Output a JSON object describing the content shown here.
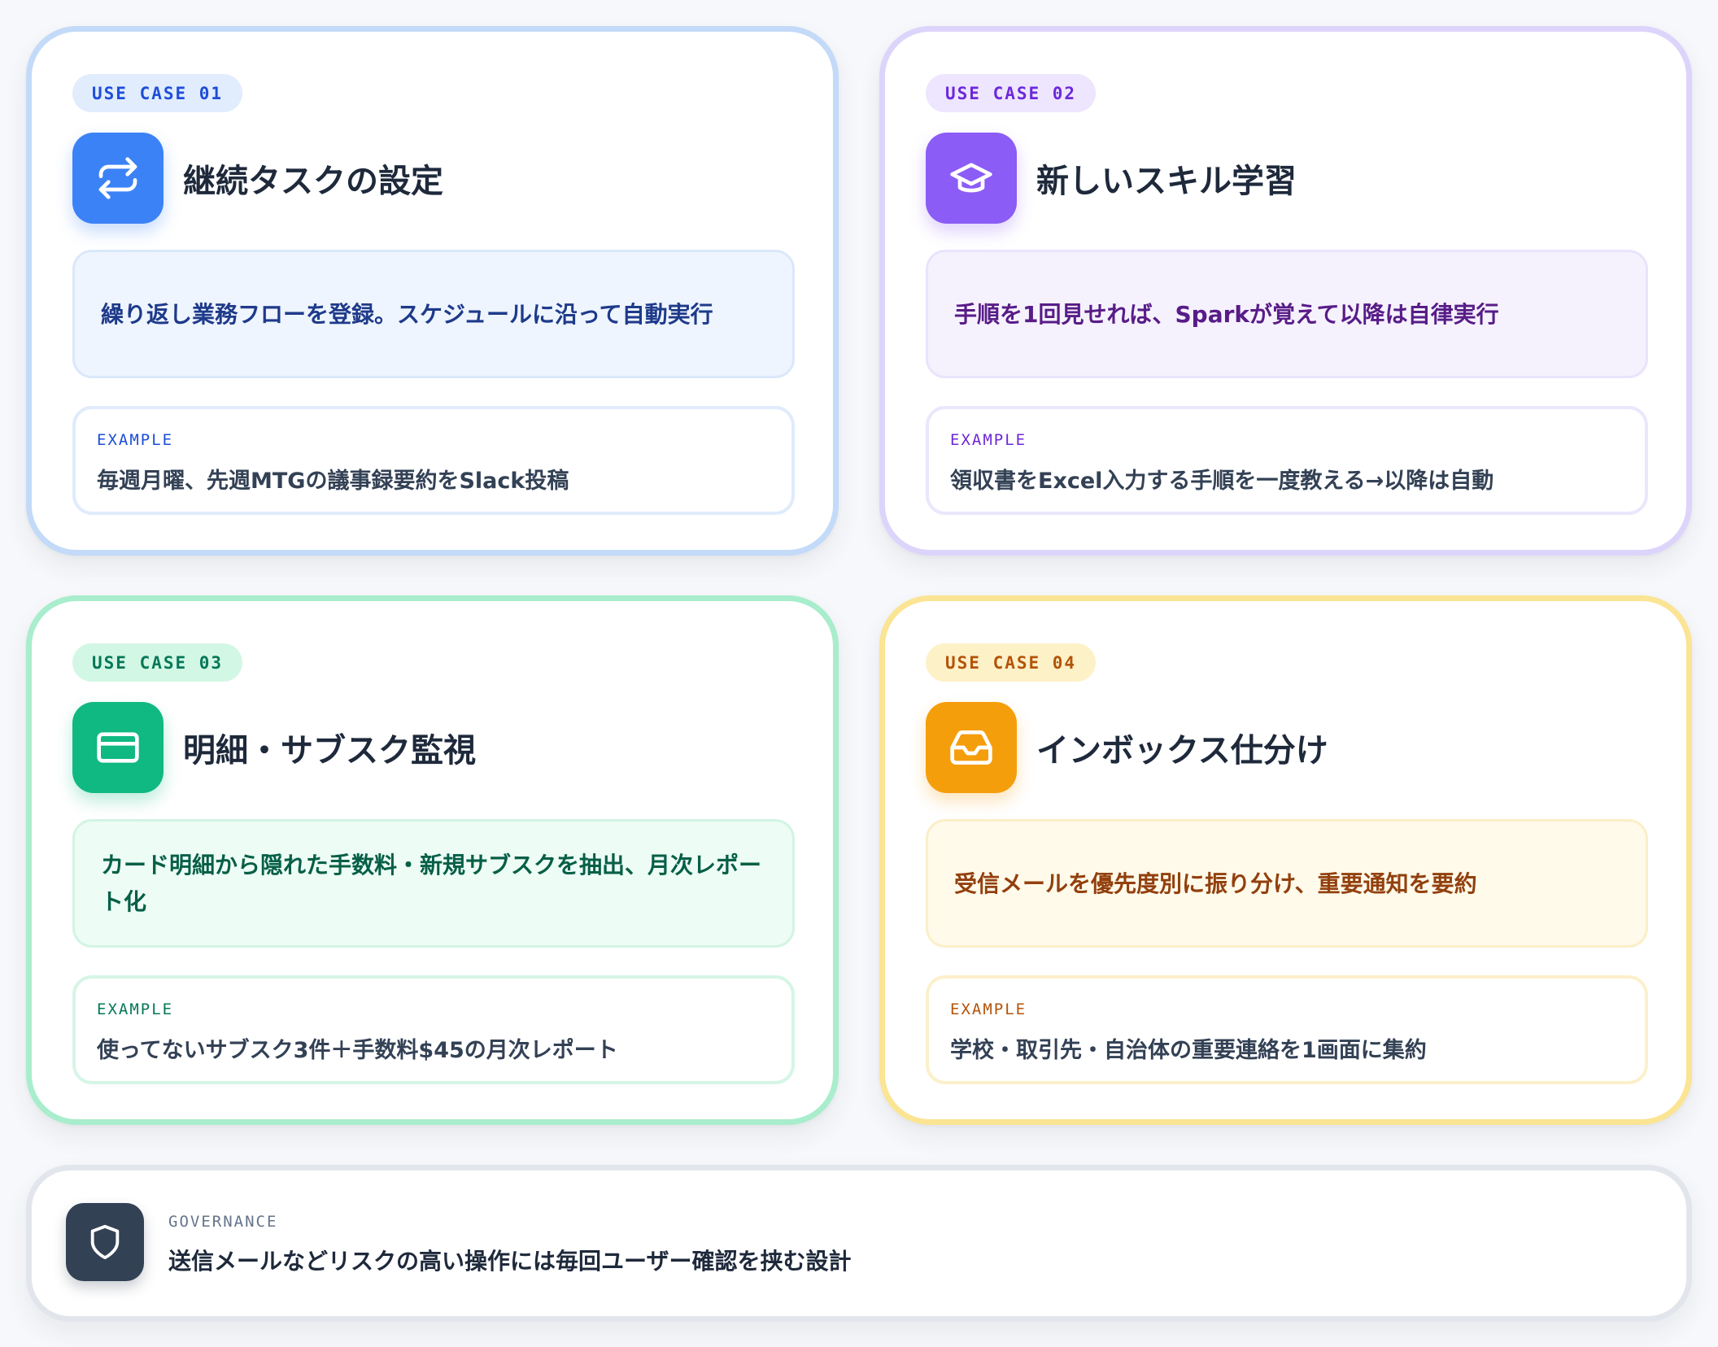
{
  "cards": [
    {
      "badge": "USE CASE 01",
      "icon": "repeat-icon",
      "title": "継続タスクの設定",
      "description": "繰り返し業務フローを登録。スケジュールに沿って自動実行",
      "example_label": "EXAMPLE",
      "example": "毎週月曜、先週MTGの議事録要約をSlack投稿",
      "accent": "#3b82f6"
    },
    {
      "badge": "USE CASE 02",
      "icon": "graduation-cap-icon",
      "title": "新しいスキル学習",
      "description": "手順を1回見せれば、Sparkが覚えて以降は自律実行",
      "example_label": "EXAMPLE",
      "example": "領収書をExcel入力する手順を一度教える→以降は自動",
      "accent": "#8b5cf6"
    },
    {
      "badge": "USE CASE 03",
      "icon": "credit-card-icon",
      "title": "明細・サブスク監視",
      "description": "カード明細から隠れた手数料・新規サブスクを抽出、月次レポート化",
      "example_label": "EXAMPLE",
      "example": "使ってないサブスク3件＋手数料$45の月次レポート",
      "accent": "#10b981"
    },
    {
      "badge": "USE CASE 04",
      "icon": "inbox-icon",
      "title": "インボックス仕分け",
      "description": "受信メールを優先度別に振り分け、重要通知を要約",
      "example_label": "EXAMPLE",
      "example": "学校・取引先・自治体の重要連絡を1画面に集約",
      "accent": "#f59e0b"
    }
  ],
  "governance": {
    "icon": "shield-icon",
    "label": "GOVERNANCE",
    "text": "送信メールなどリスクの高い操作には毎回ユーザー確認を挟む設計"
  }
}
